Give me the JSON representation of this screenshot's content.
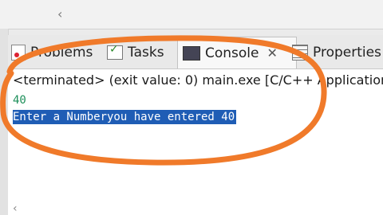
{
  "tabs": [
    {
      "label": "Problems",
      "icon": "problems-icon"
    },
    {
      "label": "Tasks",
      "icon": "tasks-icon"
    },
    {
      "label": "Console",
      "icon": "console-icon",
      "active": true
    },
    {
      "label": "Properties",
      "icon": "properties-icon"
    }
  ],
  "console": {
    "status": "<terminated> (exit value: 0) main.exe [C/C++ Application",
    "lines": [
      "40",
      "Enter a Numberyou have entered 40"
    ]
  },
  "colors": {
    "annotation": "#f07a2a",
    "selection": "#1f5db5",
    "input_text": "#1d8f5a"
  }
}
